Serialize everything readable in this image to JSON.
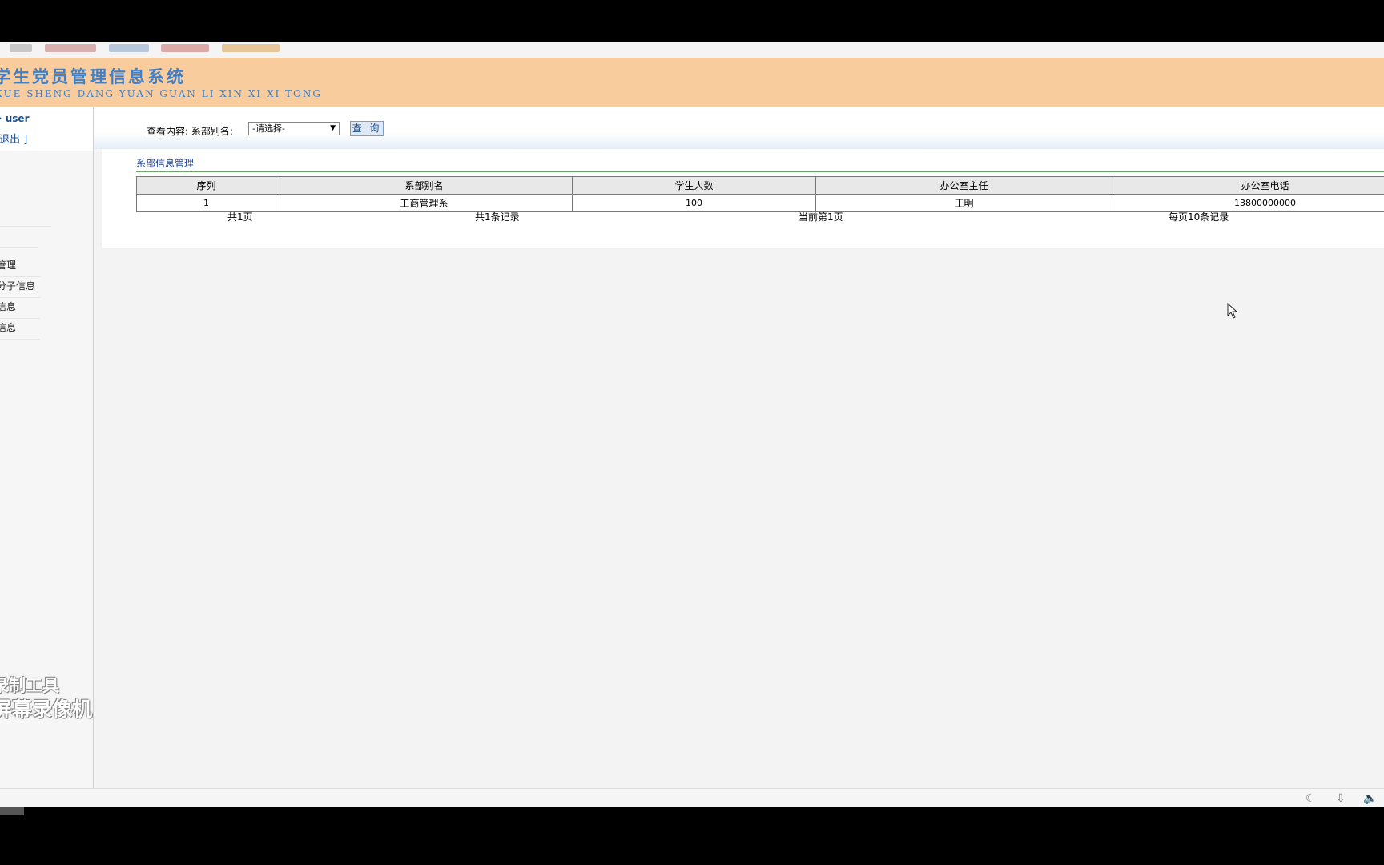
{
  "header": {
    "title": "学生党员管理信息系统",
    "subtitle": "XUE SHENG DANG YUAN GUAN LI XIN XI XI TONG"
  },
  "sidebar": {
    "user_label": "user",
    "logout_label": "[退出 ]",
    "menu_items": [
      {
        "label": "管理"
      },
      {
        "label": "分子信息"
      },
      {
        "label": "信息"
      },
      {
        "label": "信息"
      }
    ],
    "watermark_line1": "录制工具",
    "watermark_line2": "屏幕录像机"
  },
  "query": {
    "label": "查看内容: 系部别名:",
    "select_value": "-请选择-",
    "button_label": "查 询"
  },
  "section": {
    "title": "系部信息管理"
  },
  "table": {
    "headers": [
      "序列",
      "系部别名",
      "学生人数",
      "办公室主任",
      "办公室电话"
    ],
    "rows": [
      {
        "index": "1",
        "name": "工商管理系",
        "students": "100",
        "director": "王明",
        "phone": "13800000000"
      }
    ]
  },
  "pager": {
    "total_pages": "共1页",
    "total_records": "共1条记录",
    "current_page": "当前第1页",
    "per_page": "每页10条记录"
  }
}
